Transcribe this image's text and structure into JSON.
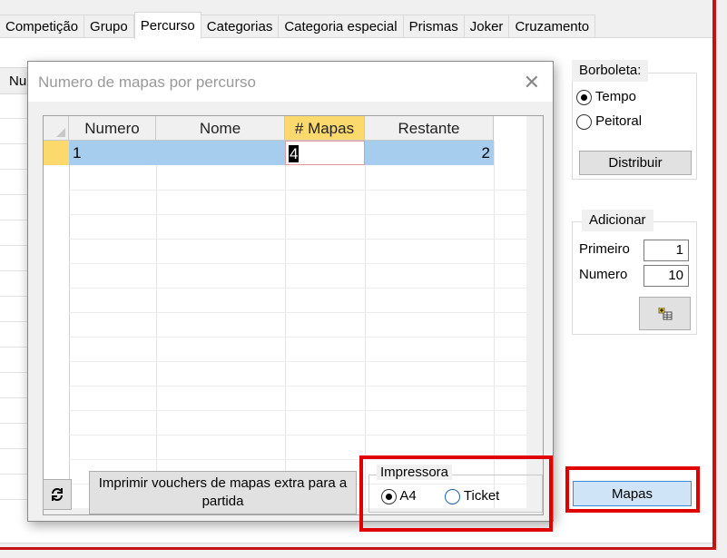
{
  "tabs": [
    "Competição",
    "Grupo",
    "Percurso",
    "Categorias",
    "Categoria especial",
    "Prismas",
    "Joker",
    "Cruzamento"
  ],
  "active_tab_index": 2,
  "background_grid": {
    "header_fragment": "Nu"
  },
  "right_panel": {
    "borboleta": {
      "title": "Borboleta:",
      "options": [
        {
          "label": "Tempo",
          "checked": true
        },
        {
          "label": "Peitoral",
          "checked": false
        }
      ],
      "button_label": "Distribuir"
    },
    "adicionar": {
      "title": "Adicionar",
      "primeiro_label": "Primeiro",
      "primeiro_value": "1",
      "numero_label": "Numero",
      "numero_value": "10",
      "add_icon": "add-rows-icon"
    },
    "mapas_button_label": "Mapas"
  },
  "dialog": {
    "title": "Numero de mapas por percurso",
    "close_glyph": "✕",
    "columns": [
      "Numero",
      "Nome",
      "# Mapas",
      "Restante"
    ],
    "rows": [
      {
        "numero": "1",
        "nome": "",
        "mapas": "4",
        "restante": "2"
      }
    ],
    "refresh_icon": "refresh-icon",
    "print_button_label": "Imprimir vouchers de mapas extra para a partida",
    "impressora": {
      "title": "Impressora",
      "options": [
        {
          "label": "A4",
          "checked": true
        },
        {
          "label": "Ticket",
          "checked": false
        }
      ]
    }
  },
  "colors": {
    "selected_row": "#a6cdee",
    "selected_header": "#fbd96c",
    "row_indicator": "#fbd96c",
    "highlight": "#e00000",
    "mapas_button": "#cfe4f7"
  }
}
